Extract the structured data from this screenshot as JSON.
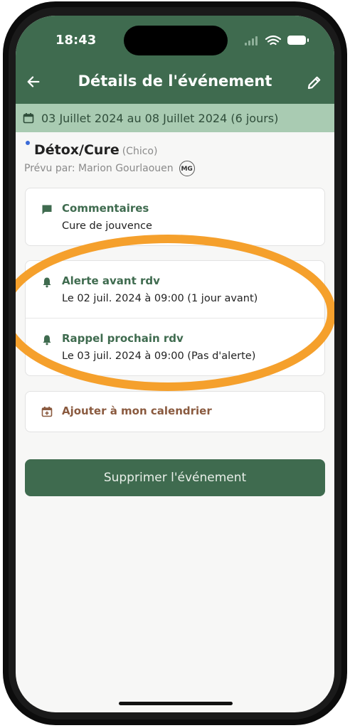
{
  "status_bar": {
    "time": "18:43",
    "signal_icon": "signal-icon",
    "wifi_icon": "wifi-icon",
    "battery_icon": "battery-icon"
  },
  "nav": {
    "title": "Détails de l'événement",
    "back_icon": "arrow-left-icon",
    "edit_icon": "pencil-icon"
  },
  "date_bar": {
    "icon": "calendar-icon",
    "text": "03 Juillet 2024 au 08 Juillet 2024 (6 jours)"
  },
  "event": {
    "title": "Détox/Cure",
    "subtitle": "(Chico)",
    "planned_by": "Prévu par: Marion Gourlaouen",
    "avatar_initials": "MG"
  },
  "comments": {
    "icon": "comment-icon",
    "label": "Commentaires",
    "value": "Cure de jouvence"
  },
  "reminders": [
    {
      "icon": "bell-icon",
      "label": "Alerte avant rdv",
      "value": "Le 02 juil. 2024 à 09:00 (1 jour avant)"
    },
    {
      "icon": "bell-icon",
      "label": "Rappel prochain rdv",
      "value": "Le 03 juil. 2024 à 09:00 (Pas d'alerte)"
    }
  ],
  "calendar_action": {
    "icon": "calendar-plus-icon",
    "label": "Ajouter à mon calendrier"
  },
  "delete_button": {
    "label": "Supprimer l'événement"
  },
  "colors": {
    "header": "#3f6b4f",
    "date_bar": "#a9cbb2",
    "accent_brown": "#8a5a3f",
    "annotation": "#f5a02c",
    "event_dot": "#3b6bd8"
  }
}
